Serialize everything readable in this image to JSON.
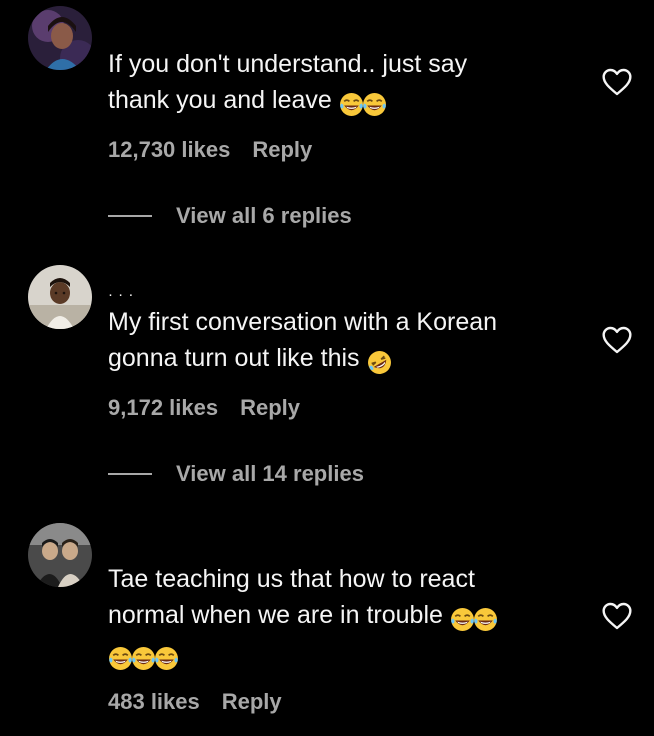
{
  "colors": {
    "background": "#000000",
    "primary_text": "#f5f5f5",
    "secondary_text": "#a8a8a8"
  },
  "comments": [
    {
      "username": "",
      "text": "If you don't understand.. just say\nthank you and leave",
      "emojis": [
        "face-with-tears-of-joy",
        "face-with-tears-of-joy"
      ],
      "likes": "12,730 likes",
      "reply_label": "Reply",
      "view_replies": "View all 6 replies",
      "heart_icon": "heart-outline-icon"
    },
    {
      "username": "· · ·",
      "text": "My first conversation with a Korean\ngonna turn out like this",
      "emojis": [
        "rolling-on-the-floor-laughing"
      ],
      "likes": "9,172 likes",
      "reply_label": "Reply",
      "view_replies": "View all 14 replies",
      "heart_icon": "heart-outline-icon"
    },
    {
      "username": "",
      "text": "Tae teaching us that how to react\nnormal when we are in trouble",
      "emojis": [
        "face-with-tears-of-joy",
        "face-with-tears-of-joy",
        "face-with-tears-of-joy",
        "face-with-tears-of-joy",
        "face-with-tears-of-joy"
      ],
      "likes": "483 likes",
      "reply_label": "Reply",
      "heart_icon": "heart-outline-icon"
    }
  ]
}
